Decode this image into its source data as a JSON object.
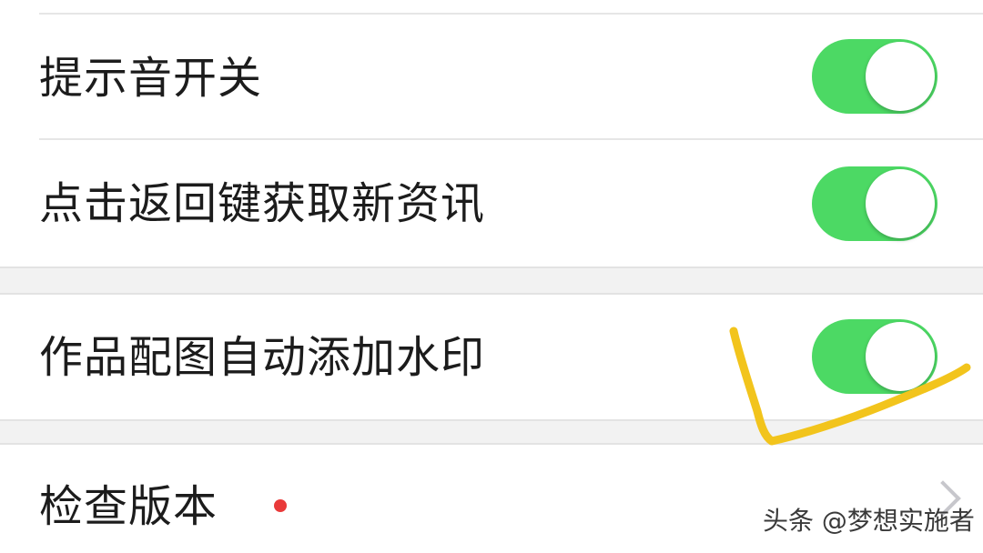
{
  "settings": {
    "items": [
      {
        "label": "提示音开关",
        "control": "toggle",
        "state": "on"
      },
      {
        "label": "点击返回键获取新资讯",
        "control": "toggle",
        "state": "on"
      },
      {
        "label": "作品配图自动添加水印",
        "control": "toggle",
        "state": "on"
      },
      {
        "label": "检查版本",
        "control": "chevron",
        "badge": "red-dot"
      }
    ]
  },
  "watermark": {
    "text": "头条 @梦想实施者"
  },
  "colors": {
    "toggle_on": "#4cd964",
    "badge": "#e93a3a",
    "annotation": "#f2c41c",
    "section_gap": "#f2f2f2"
  },
  "icons": {
    "toggle_knob": "toggle-knob-icon",
    "chevron": "chevron-right-icon",
    "badge": "red-dot-icon"
  }
}
